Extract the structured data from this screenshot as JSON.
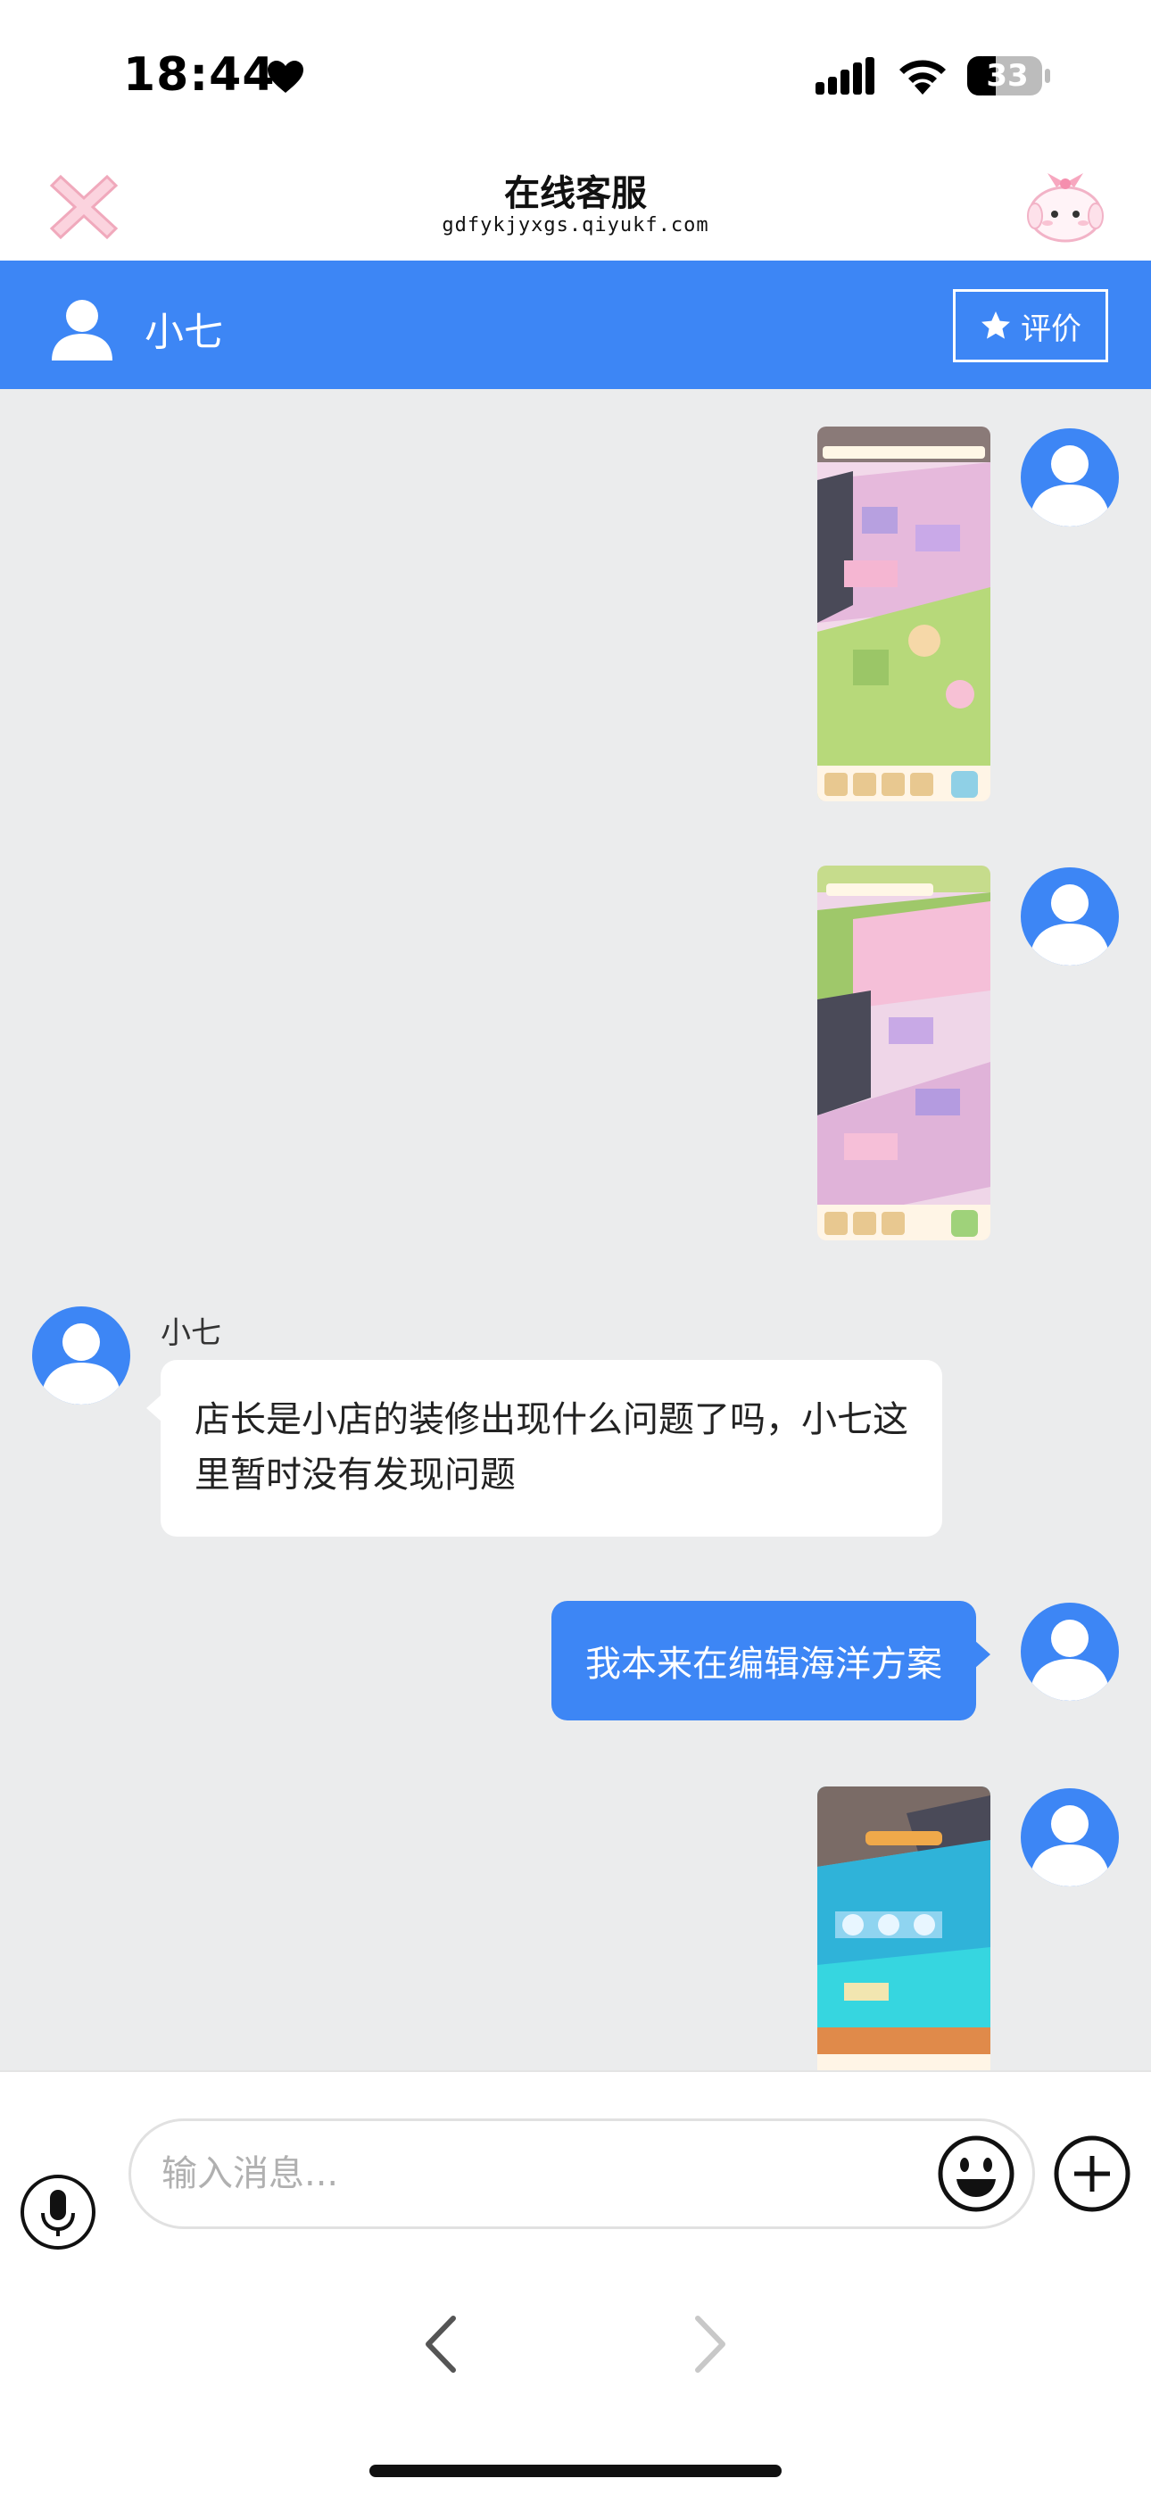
{
  "status_bar": {
    "time": "18:44",
    "battery": "33",
    "icons": [
      "heart-icon",
      "cellular-signal-icon",
      "wifi-icon",
      "battery-icon"
    ]
  },
  "header": {
    "title": "在线客服",
    "url": "gdfykjyxgs.qiyukf.com",
    "left_icon": "close-icon",
    "right_icon": "mascot-icon"
  },
  "agent_bar": {
    "name": "小七",
    "rate_label": "评价",
    "accent": "#3d86f5"
  },
  "messages": [
    {
      "type": "image",
      "direction": "outgoing",
      "icon": "game-screenshot"
    },
    {
      "type": "image",
      "direction": "outgoing",
      "icon": "game-screenshot"
    },
    {
      "type": "text",
      "direction": "incoming",
      "sender": "小七",
      "text": "店长是小店的装修出现什么问题了吗，小七这里暂时没有发现问题"
    },
    {
      "type": "text",
      "direction": "outgoing",
      "text": "我本来在编辑海洋方案"
    },
    {
      "type": "image",
      "direction": "outgoing",
      "icon": "game-screenshot"
    }
  ],
  "input_bar": {
    "placeholder": "输入消息...",
    "icons": [
      "microphone-icon",
      "emoji-icon",
      "plus-icon"
    ]
  },
  "browser_nav": {
    "icons": [
      "chevron-left-icon",
      "chevron-right-icon"
    ]
  },
  "colors": {
    "accent": "#3d86f5",
    "chat_background": "#ebeced",
    "bubble_incoming": "#ffffff"
  }
}
